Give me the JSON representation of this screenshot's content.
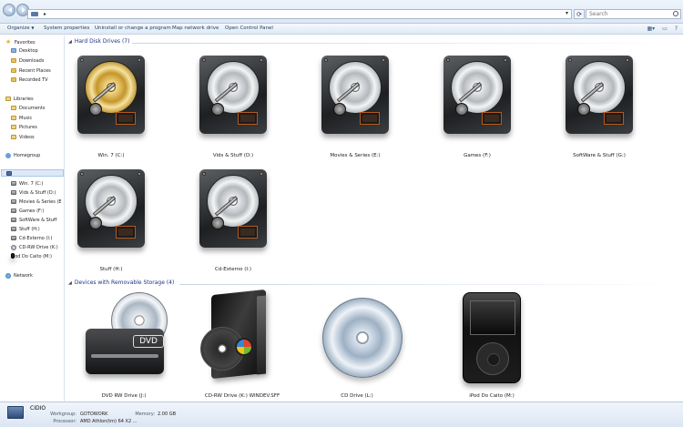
{
  "search": {
    "placeholder": "Search"
  },
  "toolbar": {
    "organize": "Organize",
    "system_properties": "System properties",
    "uninstall": "Uninstall or change a program",
    "map_network": "Map network drive",
    "control_panel": "Open Control Panel"
  },
  "nav": {
    "favorites": "Favorites",
    "favorites_items": [
      "Desktop",
      "Downloads",
      "Recent Places",
      "Recorded TV"
    ],
    "libraries": "Libraries",
    "libraries_items": [
      "Documents",
      "Music",
      "Pictures",
      "Videos"
    ],
    "homegroup": "Homegroup",
    "computer_items": [
      "Win. 7 (C:)",
      "Vids & Stuff (D:)",
      "Movies & Series (E",
      "Games (F:)",
      "SoftWare & Stuff",
      "Stuff (H:)",
      "Cd-Externo (I:)",
      "CD-RW Drive (K:)",
      "iPod Do Caito (M:)"
    ],
    "network": "Network"
  },
  "groups": {
    "hdd": "Hard Disk Drives (7)",
    "removable": "Devices with Removable Storage (4)"
  },
  "hdd_items": [
    {
      "label": "Win. 7 (C:)",
      "style": "gold"
    },
    {
      "label": "Vids & Stuff (D:)",
      "style": "silver"
    },
    {
      "label": "Movies & Series (E:)",
      "style": "silver"
    },
    {
      "label": "Games (F:)",
      "style": "silver"
    },
    {
      "label": "SoftWare & Stuff (G:)",
      "style": "silver"
    },
    {
      "label": "Stuff (H:)",
      "style": "silver"
    },
    {
      "label": "Cd-Externo (I:)",
      "style": "silver"
    }
  ],
  "removable_items": [
    {
      "label": "DVD RW Drive (J:)",
      "icon": "dvd-drive",
      "badge": "DVD"
    },
    {
      "label": "CD-RW Drive (K:) WINDEV.SFF",
      "icon": "windows-disc"
    },
    {
      "label": "CD Drive (L:)",
      "icon": "cd-disc"
    },
    {
      "label": "iPod Do Caito (M:)",
      "icon": "ipod"
    }
  ],
  "details": {
    "computer_name": "CIDIO",
    "workgroup_label": "Workgroup:",
    "workgroup_value": "GOTOWORK",
    "memory_label": "Memory:",
    "memory_value": "2.00 GB",
    "processor_label": "Processor:",
    "processor_value": "AMD Athlon(tm) 64 X2 ..."
  }
}
